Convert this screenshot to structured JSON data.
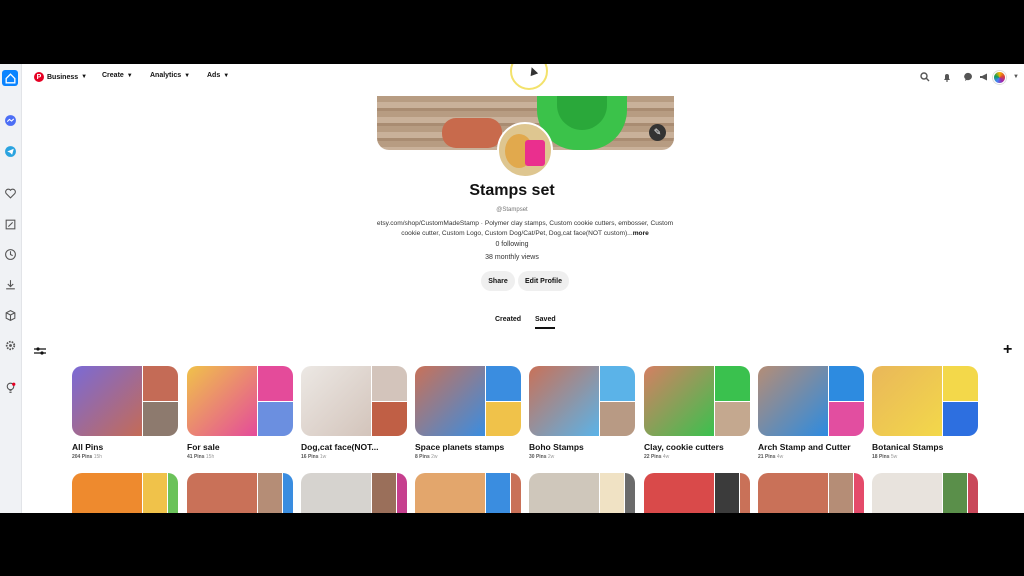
{
  "nav": {
    "business": "Business",
    "create": "Create",
    "analytics": "Analytics",
    "ads": "Ads"
  },
  "profile": {
    "name": "Stamps set",
    "handle": "@Stampset",
    "bio_link": "etsy.com/shop/CustomMadeStamp",
    "bio_text": " · Polymer clay stamps, Custom cookie cutters, embosser, Custom cookie cutter, Custom Logo, Custom Dog/Cat/Pet, Dog,cat face(NOT custom)...",
    "bio_more": "more",
    "following": "0 following",
    "views": "38 monthly views",
    "share": "Share",
    "edit": "Edit Profile"
  },
  "tabs": {
    "created": "Created",
    "saved": "Saved"
  },
  "boards": [
    {
      "name": "All Pins",
      "pins": "204 Pins",
      "age": "15h",
      "colors": [
        "#7a6ad6",
        "#c46b56",
        "#8d7a6e"
      ]
    },
    {
      "name": "For sale",
      "pins": "41 Pins",
      "age": "15h",
      "colors": [
        "#f0c24a",
        "#e44b9a",
        "#6b8fe0"
      ]
    },
    {
      "name": "Dog,cat face(NOT...",
      "pins": "16 Pins",
      "age": "1w",
      "colors": [
        "#ece8e4",
        "#d3c4bb",
        "#c05f45"
      ]
    },
    {
      "name": "Space planets stamps",
      "pins": "8 Pins",
      "age": "2w",
      "colors": [
        "#c97158",
        "#3a8de0",
        "#f0c24a"
      ]
    },
    {
      "name": "Boho Stamps",
      "pins": "30 Pins",
      "age": "2w",
      "colors": [
        "#c97158",
        "#5bb3e8",
        "#b89a84"
      ]
    },
    {
      "name": "Clay, cookie cutters",
      "pins": "22 Pins",
      "age": "4w",
      "colors": [
        "#d57f63",
        "#3ac14e",
        "#c4a88f"
      ]
    },
    {
      "name": "Arch Stamp and Cutter",
      "pins": "21 Pins",
      "age": "4w",
      "colors": [
        "#b58d76",
        "#2d8be0",
        "#e24ea0"
      ]
    },
    {
      "name": "Botanical Stamps",
      "pins": "18 Pins",
      "age": "5w",
      "colors": [
        "#e9b75a",
        "#f3d84a",
        "#2d6fe0"
      ]
    }
  ],
  "row2_colors": [
    [
      "#ee8a2e",
      "#f0c24a",
      "#6bc25a"
    ],
    [
      "#c97158",
      "#b58d76",
      "#3a8de0"
    ],
    [
      "#d6d3cf",
      "#9a6f5a",
      "#c63f8e"
    ],
    [
      "#e3a66c",
      "#3a8de0",
      "#c97158"
    ],
    [
      "#cfc7bb",
      "#f0e2c4",
      "#6b6b6b"
    ],
    [
      "#d94a4a",
      "#3b3b3b",
      "#c97158"
    ],
    [
      "#c97158",
      "#b58d76",
      "#e44b6a"
    ],
    [
      "#e8e3dd",
      "#5a8f4a",
      "#c9485a"
    ]
  ]
}
